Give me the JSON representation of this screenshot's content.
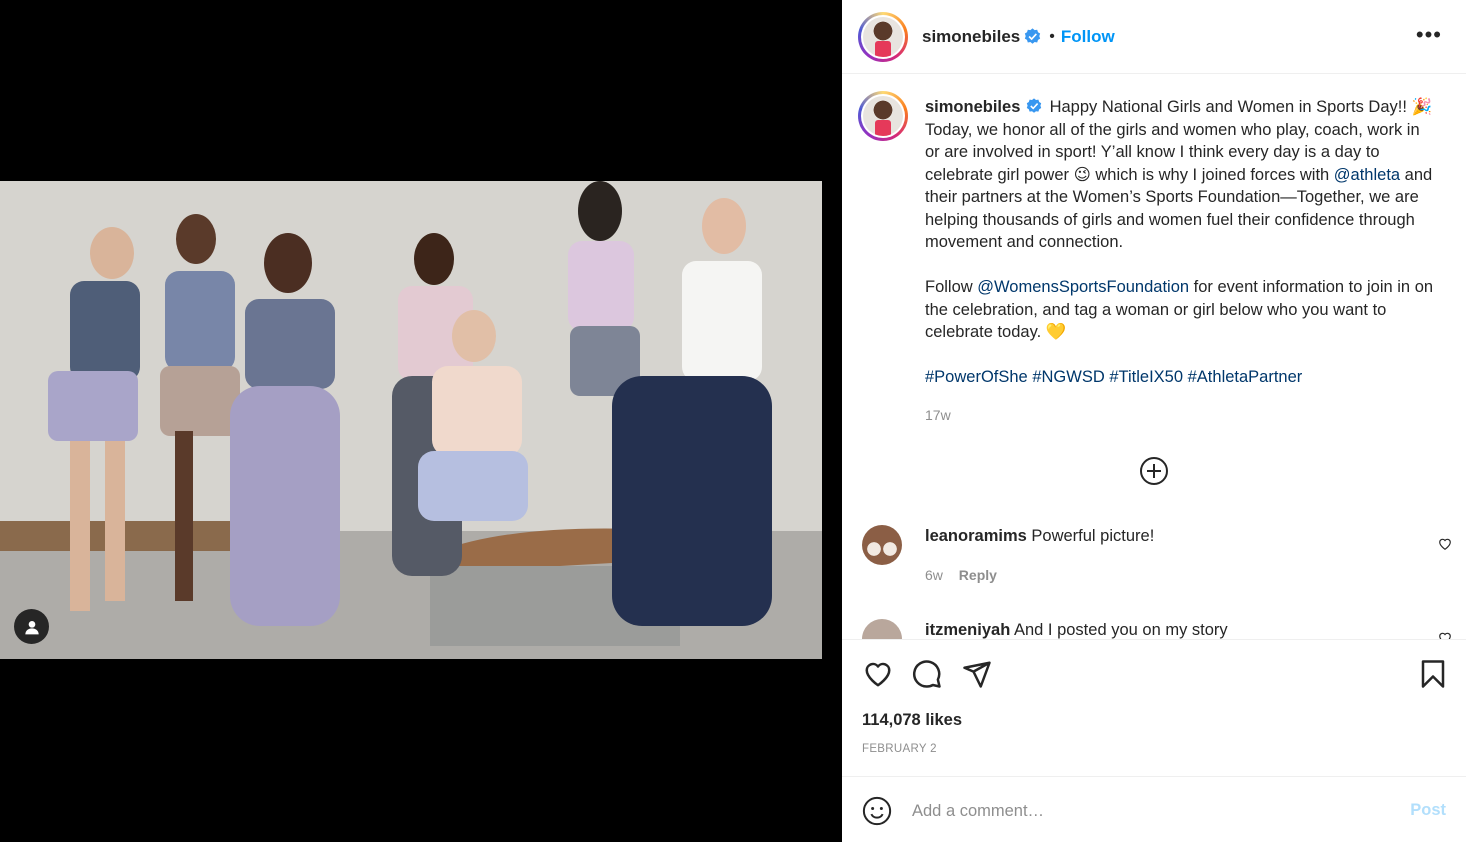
{
  "post": {
    "author": "simonebiles",
    "follow_label": "Follow",
    "separator": "•",
    "more_label": "•••"
  },
  "caption": {
    "username": "simonebiles",
    "text_1": "Happy National Girls and Women in Sports Day!! 🎉 Today, we honor all of the girls and women who play, coach, work in or are involved in sport! Y’all know I think every day is a day to celebrate girl power 😉 which is why I joined forces with ",
    "mention_1": "@athleta",
    "text_2": " and their partners at the Women’s Sports Foundation—Together, we are helping thousands of girls and women fuel their confidence through movement and connection.",
    "text_3": "Follow ",
    "mention_2": "@WomensSportsFoundation",
    "text_4": " for event information to join in on the celebration, and tag a woman or girl below who you want to celebrate today. 💛",
    "hashtags": [
      "#PowerOfShe",
      "#NGWSD",
      "#TitleIX50",
      "#AthletaPartner"
    ],
    "time": "17w"
  },
  "comments": [
    {
      "user": "leanoramims",
      "text": "Powerful picture!",
      "time": "6w",
      "reply_label": "Reply"
    },
    {
      "user": "itzmeniyah",
      "text": "And I posted you on my story"
    }
  ],
  "stats": {
    "likes": "114,078 likes",
    "date": "FEBRUARY 2"
  },
  "comment_box": {
    "placeholder": "Add a comment…",
    "post_label": "Post"
  },
  "colors": {
    "follow": "#0095f6",
    "post_disabled": "#b2dffc",
    "verified": "#3897f0",
    "link": "#00376b"
  }
}
